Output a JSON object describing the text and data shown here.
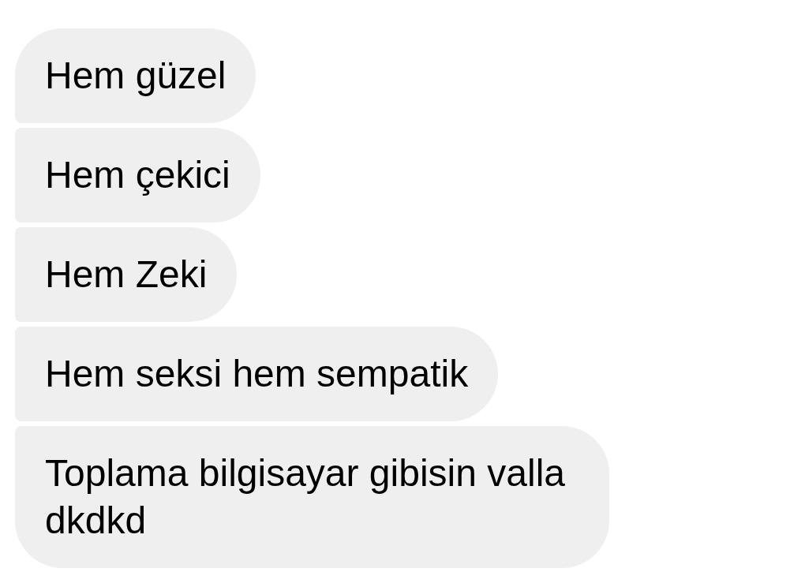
{
  "messages": [
    {
      "text": "Hem güzel"
    },
    {
      "text": "Hem çekici"
    },
    {
      "text": "Hem Zeki"
    },
    {
      "text": "Hem seksi hem sempatik"
    },
    {
      "text": "Toplama bilgisayar gibisin valla dkdkd"
    }
  ]
}
